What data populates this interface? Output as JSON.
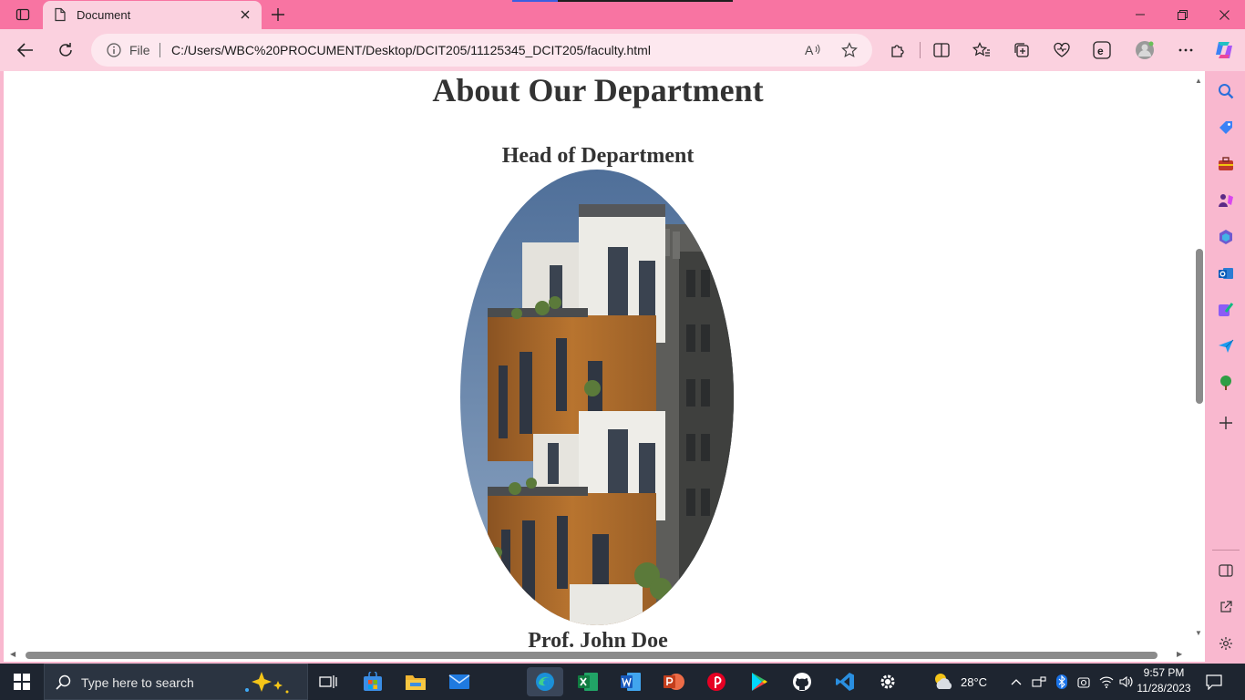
{
  "browser": {
    "tab_title": "Document",
    "address": {
      "scheme_label": "File",
      "url": "C:/Users/WBC%20PROCUMENT/Desktop/DCIT205/11125345_DCIT205/faculty.html"
    }
  },
  "page": {
    "heading": "About Our Department",
    "section_title": "Head of Department",
    "head_name": "Prof. John Doe"
  },
  "taskbar": {
    "search_placeholder": "Type here to search",
    "weather": "28°C",
    "time": "9:57 PM",
    "date": "11/28/2023"
  },
  "colors": {
    "titlebar": "#f874a2",
    "toolbar": "#fbd1df",
    "taskbar": "#1e2530"
  }
}
